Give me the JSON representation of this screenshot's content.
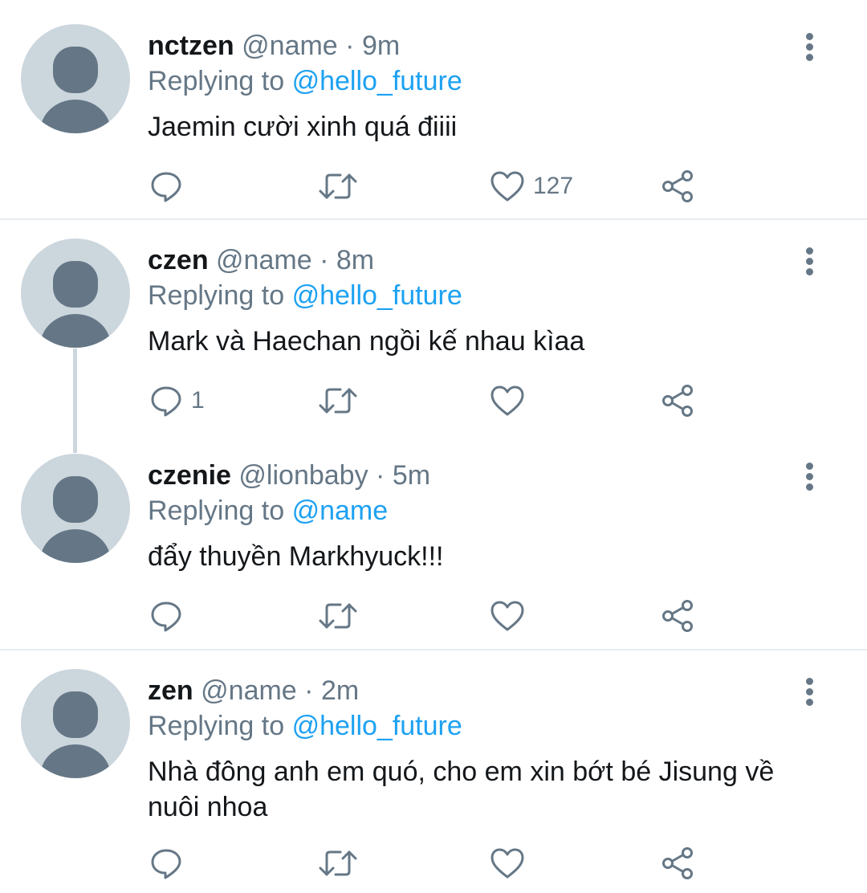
{
  "colors": {
    "name": "#14171a",
    "muted": "#657786",
    "link": "#1da1f2",
    "avatar_bg": "#ccd6dd",
    "avatar_fg": "#657786",
    "divider": "#e6ecf0"
  },
  "icons": {
    "reply": "reply-icon",
    "retweet": "retweet-icon",
    "like": "heart-icon",
    "share": "share-icon",
    "more": "more-vertical-icon",
    "avatar": "default-avatar-icon"
  },
  "tweets": [
    {
      "name": "nctzen",
      "handle": "@name",
      "sep": "·",
      "time": "9m",
      "reply_prefix": "Replying to",
      "reply_target": "@hello_future",
      "text": "Jaemin cười xinh quá điiii",
      "replies": "",
      "retweets": "",
      "likes": "127"
    },
    {
      "name": "czen",
      "handle": "@name",
      "sep": "·",
      "time": "8m",
      "reply_prefix": "Replying to",
      "reply_target": "@hello_future",
      "text": "Mark và Haechan ngồi kế nhau kìaa",
      "replies": "1",
      "retweets": "",
      "likes": ""
    },
    {
      "name": "czenie",
      "handle": "@lionbaby",
      "sep": "·",
      "time": "5m",
      "reply_prefix": "Replying to",
      "reply_target": "@name",
      "text": "đẩy thuyền Markhyuck!!!",
      "replies": "",
      "retweets": "",
      "likes": ""
    },
    {
      "name": "zen",
      "handle": "@name",
      "sep": "·",
      "time": "2m",
      "reply_prefix": "Replying to",
      "reply_target": "@hello_future",
      "text": "Nhà đông anh em quó, cho em xin bớt bé Jisung về nuôi nhoa",
      "replies": "",
      "retweets": "",
      "likes": ""
    }
  ]
}
